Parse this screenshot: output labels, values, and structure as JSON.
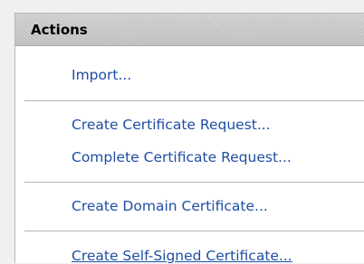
{
  "actions": {
    "title": "Actions",
    "items": [
      {
        "label": "Import..."
      },
      {
        "label": "Create Certificate Request..."
      },
      {
        "label": "Complete Certificate Request..."
      },
      {
        "label": "Create Domain Certificate..."
      },
      {
        "label": "Create Self-Signed Certificate..."
      }
    ]
  },
  "colors": {
    "link": "#1f4ea3",
    "panel_bg": "#ffffff",
    "header_bg": "#e0e0e0",
    "separator": "#b5b5b5"
  }
}
